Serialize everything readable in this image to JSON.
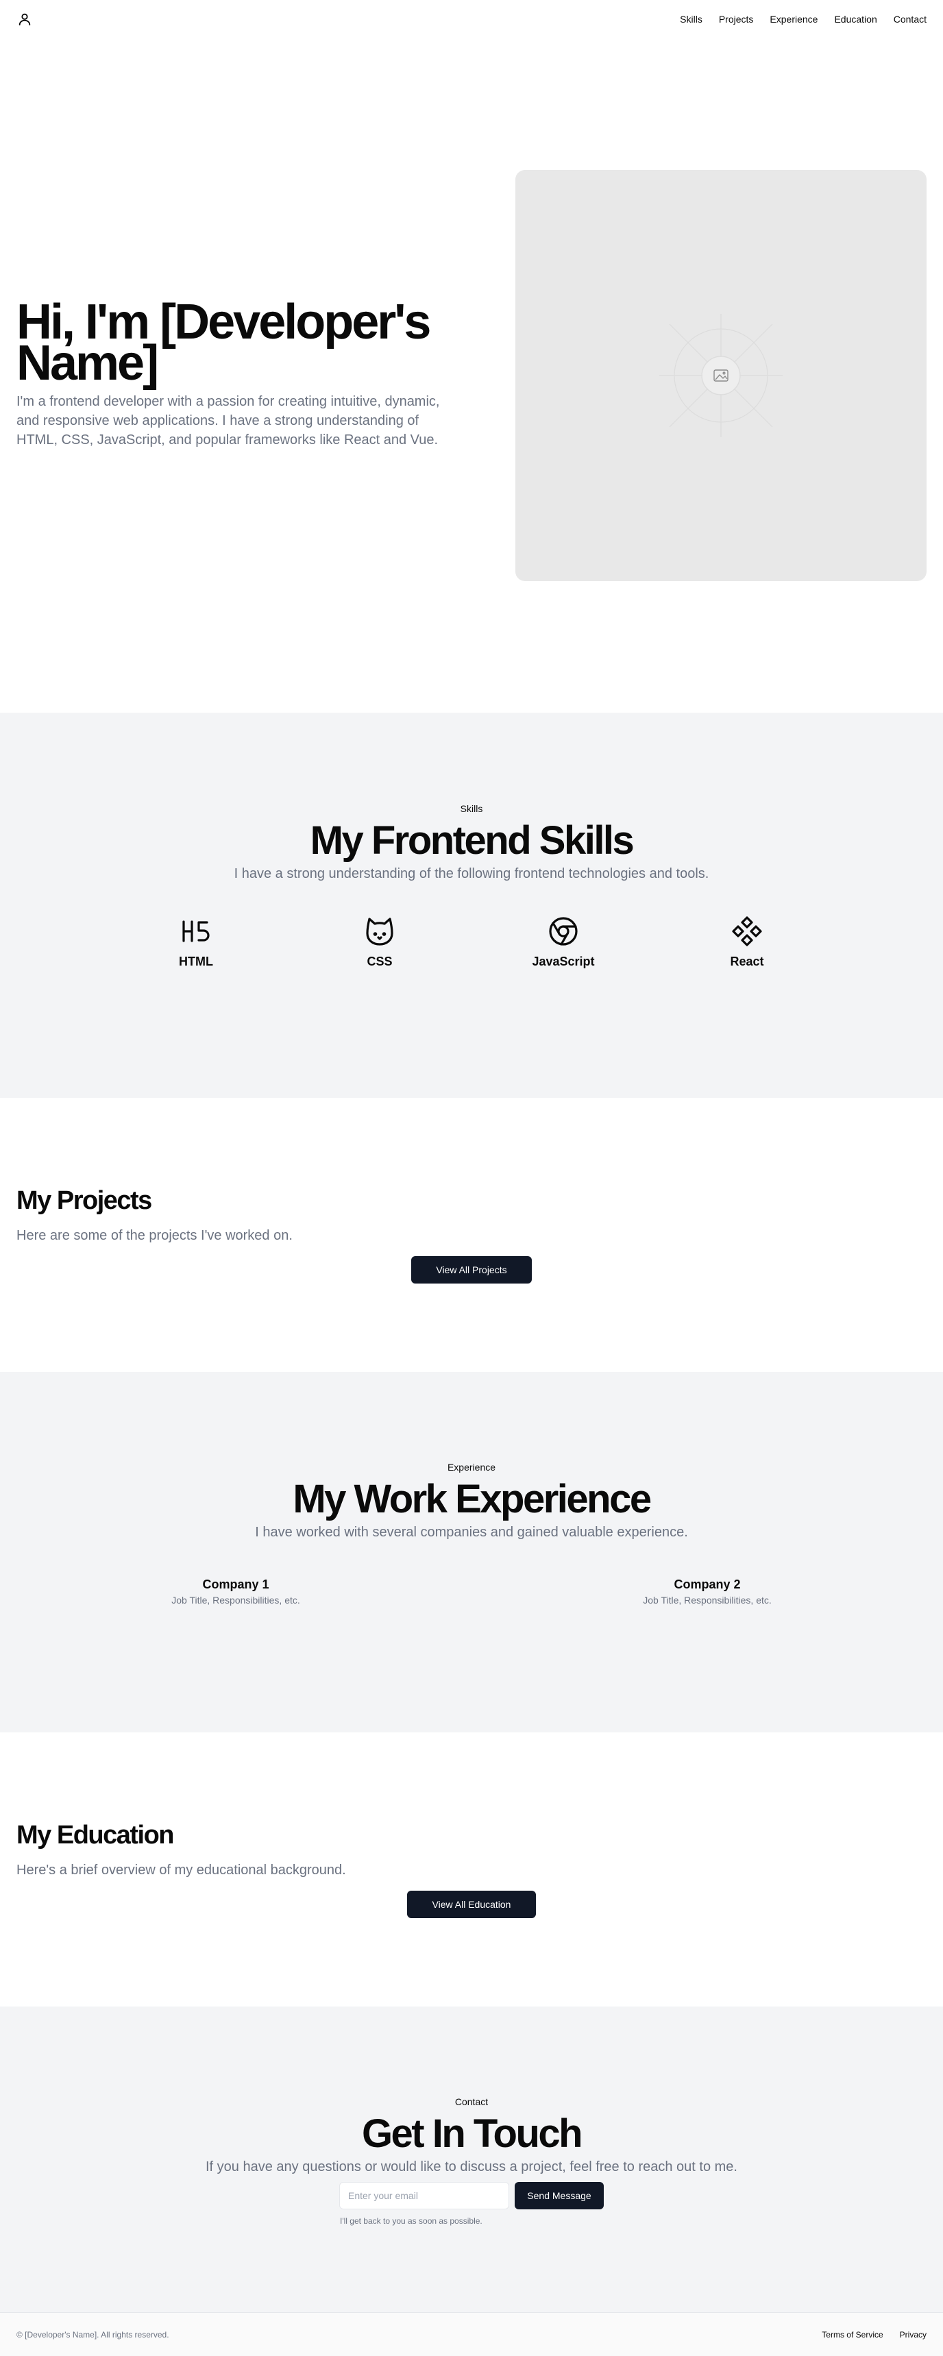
{
  "header": {
    "logo_icon": "user-icon",
    "nav": [
      "Skills",
      "Projects",
      "Experience",
      "Education",
      "Contact"
    ]
  },
  "hero": {
    "title": "Hi, I'm [Developer's Name]",
    "subtitle": "I'm a frontend developer with a passion for creating intuitive, dynamic, and responsive web applications. I have a strong understanding of HTML, CSS, JavaScript, and popular frameworks like React and Vue.",
    "image_icon": "image-placeholder-icon"
  },
  "skills": {
    "tag": "Skills",
    "title": "My Frontend Skills",
    "subtitle": "I have a strong understanding of the following frontend technologies and tools.",
    "items": [
      {
        "name": "HTML",
        "icon": "html5-icon"
      },
      {
        "name": "CSS",
        "icon": "cat-icon"
      },
      {
        "name": "JavaScript",
        "icon": "chrome-icon"
      },
      {
        "name": "React",
        "icon": "diamond-grid-icon"
      }
    ]
  },
  "projects": {
    "title": "My Projects",
    "subtitle": "Here are some of the projects I've worked on.",
    "button": "View All Projects"
  },
  "experience": {
    "tag": "Experience",
    "title": "My Work Experience",
    "subtitle": "I have worked with several companies and gained valuable experience.",
    "items": [
      {
        "company": "Company 1",
        "role": "Job Title, Responsibilities, etc."
      },
      {
        "company": "Company 2",
        "role": "Job Title, Responsibilities, etc."
      }
    ]
  },
  "education": {
    "title": "My Education",
    "subtitle": "Here's a brief overview of my educational background.",
    "button": "View All Education"
  },
  "contact": {
    "tag": "Contact",
    "title": "Get In Touch",
    "subtitle": "If you have any questions or would like to discuss a project, feel free to reach out to me.",
    "email_placeholder": "Enter your email",
    "button": "Send Message",
    "note": "I'll get back to you as soon as possible."
  },
  "footer": {
    "copyright": "© [Developer's Name]. All rights reserved.",
    "links": [
      "Terms of Service",
      "Privacy"
    ]
  }
}
